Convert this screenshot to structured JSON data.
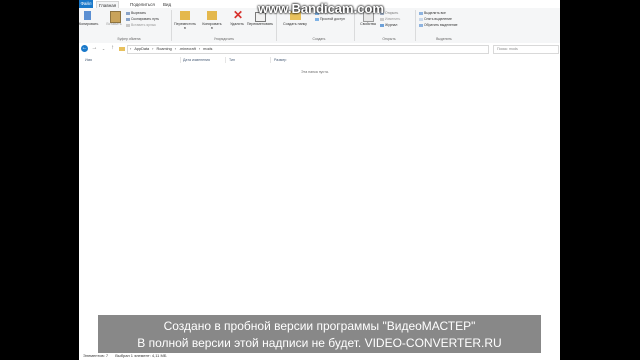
{
  "tabs": {
    "file": "Файл",
    "home": "Главная",
    "share": "Поделиться",
    "view": "Вид"
  },
  "ribbon": {
    "pin": "Закрепить на панели быстрого доступа",
    "copy": "Копировать",
    "paste": "Вставить",
    "cut": "Вырезать",
    "copy_path": "Скопировать путь",
    "paste_shortcut": "Вставить ярлык",
    "group_clipboard": "Буфер обмена",
    "move_to": "Переместить в",
    "copy_to": "Копировать в",
    "delete": "Удалить",
    "rename": "Переименовать",
    "group_organize": "Упорядочить",
    "new_folder": "Создать папку",
    "new_item": "Создать элемент",
    "easy_access": "Простой доступ",
    "group_new": "Создать",
    "properties": "Свойства",
    "open": "Открыть",
    "edit": "Изменить",
    "history": "Журнал",
    "group_open": "Открыть",
    "select_all": "Выделить все",
    "select_none": "Снять выделение",
    "invert_selection": "Обратить выделение",
    "group_select": "Выделить"
  },
  "address": {
    "path": [
      "AppData",
      "Roaming",
      ".minecraft",
      "mods"
    ],
    "search_placeholder": "Поиск: mods"
  },
  "columns": {
    "name": "Имя",
    "date": "Дата изменения",
    "type": "Тип",
    "size": "Размер"
  },
  "empty_text": "Эта папка пуста.",
  "status": {
    "items": "Элементов: 7",
    "selected": "Выбран 1 элемент: 4,11 МБ"
  },
  "watermark": {
    "bandicam": "www.Bandicam.com",
    "line1": "Создано в пробной версии программы \"ВидеоМАСТЕР\"",
    "line2": "В полной версии этой надписи не будет. VIDEO-CONVERTER.RU"
  },
  "colors": {
    "file_tab": "#1979ca",
    "ribbon_bg": "#f5f6f7",
    "overlay": "#6e6e6e"
  }
}
